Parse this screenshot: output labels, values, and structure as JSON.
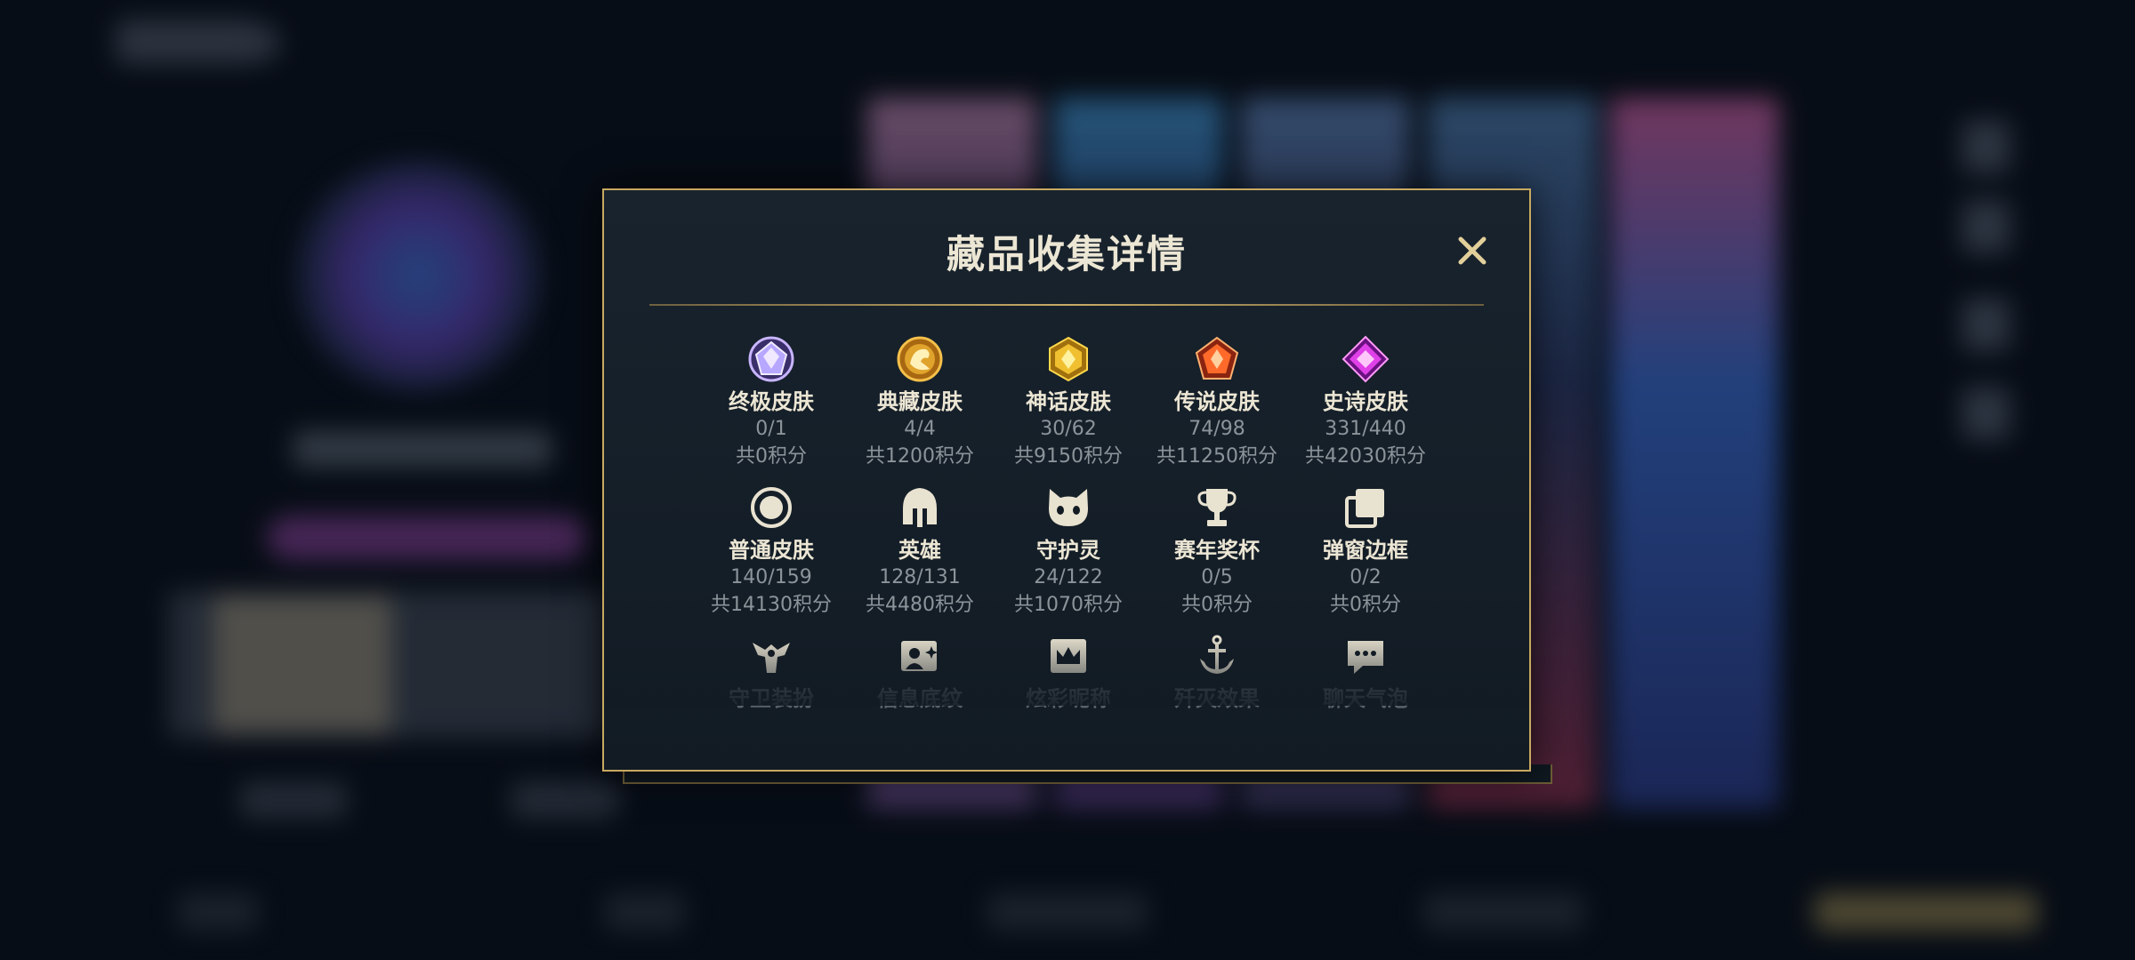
{
  "modal": {
    "title": "藏品收集详情",
    "close_icon": "close-icon"
  },
  "categories": [
    {
      "id": "ultimate-skin",
      "label": "终极皮肤",
      "count": "0/1",
      "points": "共0积分",
      "icon": "diamond-gem-icon",
      "color": "#b7a7ff"
    },
    {
      "id": "collector-skin",
      "label": "典藏皮肤",
      "count": "4/4",
      "points": "共1200积分",
      "icon": "dragon-gem-icon",
      "color": "#e0a32c"
    },
    {
      "id": "myth-skin",
      "label": "神话皮肤",
      "count": "30/62",
      "points": "共9150积分",
      "icon": "gold-gem-icon",
      "color": "#f0c030"
    },
    {
      "id": "legend-skin",
      "label": "传说皮肤",
      "count": "74/98",
      "points": "共11250积分",
      "icon": "orange-gem-icon",
      "color": "#ff6a2a"
    },
    {
      "id": "epic-skin",
      "label": "史诗皮肤",
      "count": "331/440",
      "points": "共42030积分",
      "icon": "purple-gem-icon",
      "color": "#e040e8"
    },
    {
      "id": "normal-skin",
      "label": "普通皮肤",
      "count": "140/159",
      "points": "共14130积分",
      "icon": "ring-icon",
      "color": "#e8e2d0"
    },
    {
      "id": "hero",
      "label": "英雄",
      "count": "128/131",
      "points": "共4480积分",
      "icon": "helmet-icon",
      "color": "#e8e2d0"
    },
    {
      "id": "guardian-spirit",
      "label": "守护灵",
      "count": "24/122",
      "points": "共1070积分",
      "icon": "cat-spirit-icon",
      "color": "#e8e2d0"
    },
    {
      "id": "season-trophy",
      "label": "赛年奖杯",
      "count": "0/5",
      "points": "共0积分",
      "icon": "trophy-icon",
      "color": "#e8e2d0"
    },
    {
      "id": "popup-frame",
      "label": "弹窗边框",
      "count": "0/2",
      "points": "共0积分",
      "icon": "frames-icon",
      "color": "#e8e2d0"
    },
    {
      "id": "guard-outfit",
      "label": "守卫装扮",
      "icon": "guard-statue-icon",
      "color": "#e8e2d0"
    },
    {
      "id": "info-pattern",
      "label": "信息底纹",
      "icon": "photo-sparkle-icon",
      "color": "#e8e2d0"
    },
    {
      "id": "colorful-nickname",
      "label": "炫彩昵称",
      "icon": "crown-card-icon",
      "color": "#e8e2d0"
    },
    {
      "id": "kill-effect",
      "label": "歼灭效果",
      "icon": "anchor-icon",
      "color": "#e8e2d0"
    },
    {
      "id": "chat-bubble",
      "label": "聊天气泡",
      "icon": "chat-bubble-icon",
      "color": "#e8e2d0"
    }
  ],
  "colors": {
    "accent_gold": "#c8a961",
    "title_text": "#ece6d4",
    "sub_text": "#8c949a"
  }
}
